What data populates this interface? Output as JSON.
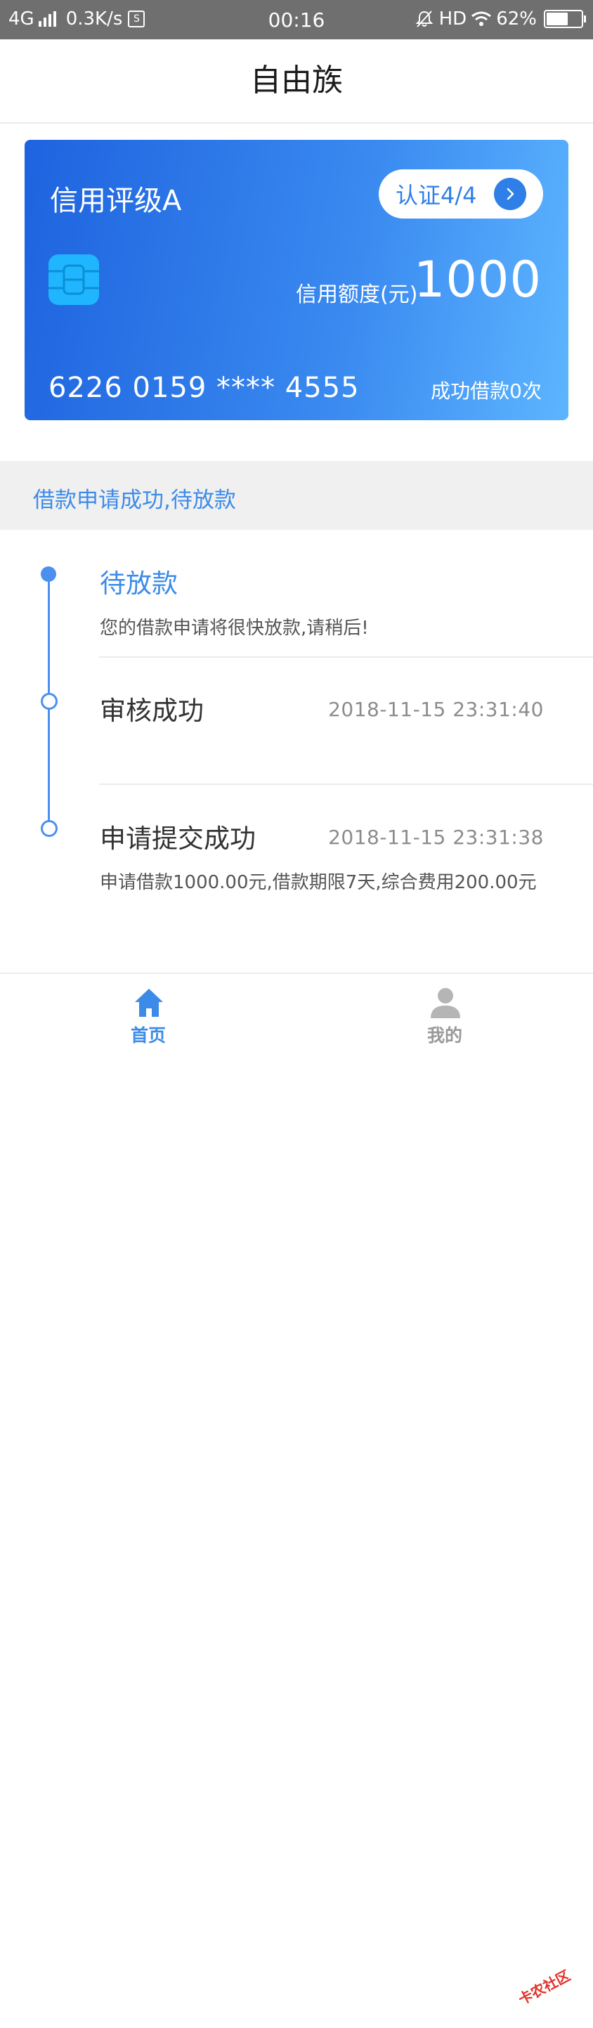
{
  "status_bar": {
    "network": "4G",
    "speed": "0.3K/s",
    "s_icon_text": "S",
    "time": "00:16",
    "hd": "HD",
    "battery_percent": "62%",
    "battery_level": 0.62
  },
  "header": {
    "title": "自由族"
  },
  "card": {
    "rating": "信用评级A",
    "auth_label": "认证4/4",
    "limit_label": "信用额度(元)",
    "limit_value": "1000",
    "card_number": "6226 0159 **** 4555",
    "success_count": "成功借款0次",
    "gradient_start": "#1e63df",
    "gradient_end": "#5db5ff"
  },
  "status_strip": {
    "text": "借款申请成功,待放款"
  },
  "timeline": {
    "steps": [
      {
        "title": "待放款",
        "desc": "您的借款申请将很快放款,请稍后!",
        "time": ""
      },
      {
        "title": "审核成功",
        "desc": "",
        "time": "2018-11-15 23:31:40"
      },
      {
        "title": "申请提交成功",
        "desc": "申请借款1000.00元,借款期限7天,综合费用200.00元",
        "time": "2018-11-15 23:31:38"
      }
    ]
  },
  "bottom_nav": {
    "items": [
      {
        "label": "首页",
        "icon": "home-icon",
        "active": true
      },
      {
        "label": "我的",
        "icon": "user-icon",
        "active": false
      }
    ]
  },
  "watermark": {
    "text": "卡农社区"
  },
  "colors": {
    "accent": "#3d8be8",
    "strip_bg": "#f0f0f0",
    "status_bar_bg": "#6f6f6f"
  }
}
